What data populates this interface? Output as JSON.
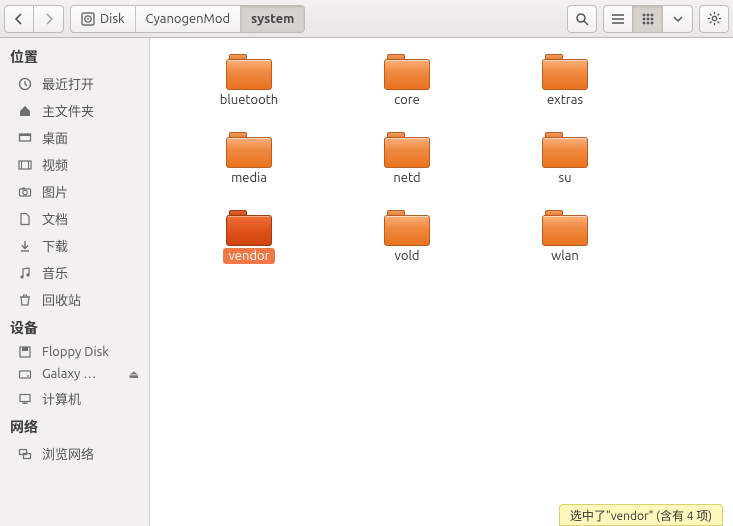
{
  "toolbar": {
    "path": [
      {
        "icon": "disk",
        "label": "Disk"
      },
      {
        "label": "CyanogenMod"
      },
      {
        "label": "system",
        "active": true
      }
    ]
  },
  "sidebar": {
    "sections": [
      {
        "heading": "位置",
        "items": [
          {
            "icon": "clock",
            "label": "最近打开"
          },
          {
            "icon": "home",
            "label": "主文件夹"
          },
          {
            "icon": "desk",
            "label": "桌面"
          },
          {
            "icon": "video",
            "label": "视频"
          },
          {
            "icon": "camera",
            "label": "图片"
          },
          {
            "icon": "doc",
            "label": "文档"
          },
          {
            "icon": "down",
            "label": "下载"
          },
          {
            "icon": "music",
            "label": "音乐"
          },
          {
            "icon": "trash",
            "label": "回收站"
          }
        ]
      },
      {
        "heading": "设备",
        "items": [
          {
            "icon": "save",
            "label": "Floppy Disk"
          },
          {
            "icon": "drive",
            "label": "Galaxy …",
            "eject": true
          },
          {
            "icon": "comp",
            "label": "计算机"
          }
        ]
      },
      {
        "heading": "网络",
        "items": [
          {
            "icon": "net",
            "label": "浏览网络"
          }
        ]
      }
    ]
  },
  "folders": [
    {
      "name": "bluetooth"
    },
    {
      "name": "core"
    },
    {
      "name": "extras"
    },
    {
      "name": "media"
    },
    {
      "name": "netd"
    },
    {
      "name": "su"
    },
    {
      "name": "vendor",
      "selected": true
    },
    {
      "name": "vold"
    },
    {
      "name": "wlan"
    }
  ],
  "status": "选中了\"vendor\" (含有 4 项)"
}
